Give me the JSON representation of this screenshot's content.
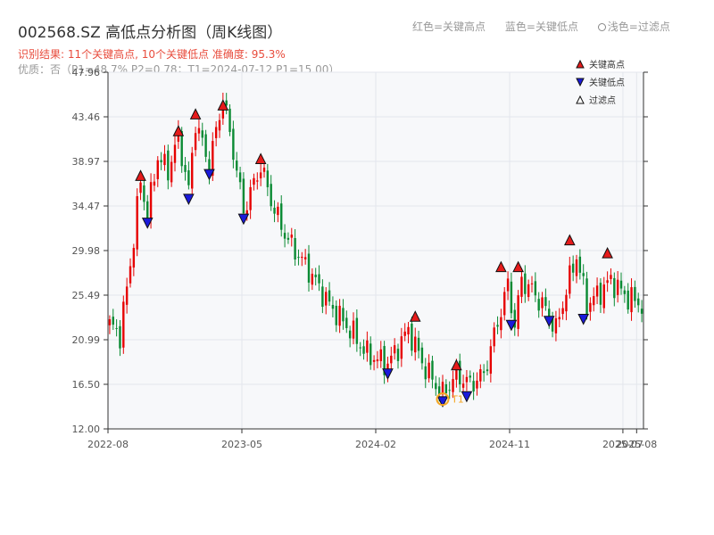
{
  "header": {
    "title": "002568.SZ 高低点分析图（周K线图）",
    "hint_red": "红色=关键高点",
    "hint_blue": "蓝色=关键低点",
    "hint_hollow": "浅色=过滤点",
    "result": "识别结果: 11个关键高点, 10个关键低点  准确度: 95.3%",
    "quality": "优质：否（P1=48.7%  P2=0.78；T1=2024-07-12 P1=15.00）"
  },
  "colors": {
    "up": "#e60000",
    "down": "#0a8a33",
    "high_marker": "#e61b1b",
    "low_marker": "#1a1adb",
    "t1_ring": "#f5a623",
    "plot_bg": "#f7f8fa",
    "grid": "#e3e6ec"
  },
  "chart_data": {
    "type": "candlestick",
    "y_ticks": [
      "47.96",
      "43.46",
      "38.97",
      "34.47",
      "29.98",
      "25.49",
      "20.99",
      "16.50",
      "12.00"
    ],
    "ylim": [
      12.0,
      47.96
    ],
    "x_ticks": [
      {
        "label": "2022-08",
        "index": 0
      },
      {
        "label": "2023-05",
        "index": 39
      },
      {
        "label": "2024-02",
        "index": 78
      },
      {
        "label": "2024-11",
        "index": 117
      },
      {
        "label": "2025-07",
        "index": 150
      },
      {
        "label": "2025-08",
        "index": 154
      }
    ],
    "bars": 156,
    "anchors": [
      [
        0,
        22.5
      ],
      [
        3,
        21.5
      ],
      [
        6,
        28.5
      ],
      [
        9,
        37.0
      ],
      [
        11,
        33.5
      ],
      [
        14,
        39.5
      ],
      [
        17,
        38.0
      ],
      [
        20,
        41.5
      ],
      [
        23,
        36.0
      ],
      [
        25,
        43.0
      ],
      [
        29,
        38.5
      ],
      [
        31,
        42.0
      ],
      [
        33,
        45.5
      ],
      [
        36,
        40.0
      ],
      [
        39,
        34.0
      ],
      [
        44,
        38.5
      ],
      [
        48,
        34.0
      ],
      [
        52,
        31.0
      ],
      [
        58,
        28.0
      ],
      [
        64,
        24.5
      ],
      [
        70,
        22.0
      ],
      [
        75,
        19.5
      ],
      [
        81,
        18.5
      ],
      [
        87,
        22.0
      ],
      [
        92,
        18.0
      ],
      [
        97,
        15.5
      ],
      [
        101,
        17.5
      ],
      [
        105,
        16.5
      ],
      [
        109,
        17.5
      ],
      [
        114,
        24.0
      ],
      [
        116,
        26.5
      ],
      [
        118,
        22.5
      ],
      [
        120,
        27.0
      ],
      [
        123,
        26.0
      ],
      [
        127,
        24.0
      ],
      [
        130,
        22.0
      ],
      [
        133,
        26.0
      ],
      [
        136,
        29.5
      ],
      [
        139,
        24.5
      ],
      [
        142,
        25.5
      ],
      [
        146,
        27.0
      ],
      [
        150,
        25.5
      ],
      [
        155,
        24.5
      ]
    ],
    "key_highs": [
      [
        9,
        37.5
      ],
      [
        20,
        42.0
      ],
      [
        25,
        43.7
      ],
      [
        33,
        44.6
      ],
      [
        44,
        39.2
      ],
      [
        89,
        23.3
      ],
      [
        101,
        18.4
      ],
      [
        114,
        28.3
      ],
      [
        119,
        28.3
      ],
      [
        134,
        31.0
      ],
      [
        145,
        29.7
      ]
    ],
    "key_lows": [
      [
        11,
        32.8
      ],
      [
        23,
        35.2
      ],
      [
        29,
        37.7
      ],
      [
        39,
        33.2
      ],
      [
        81,
        17.6
      ],
      [
        97,
        14.8
      ],
      [
        104,
        15.3
      ],
      [
        117,
        22.5
      ],
      [
        128,
        22.9
      ],
      [
        138,
        23.1
      ]
    ],
    "t1": {
      "label": "T1",
      "index": 97,
      "price": 15.0
    },
    "legend": [
      {
        "label": "关键高点",
        "kind": "high"
      },
      {
        "label": "关键低点",
        "kind": "low"
      },
      {
        "label": "过滤点",
        "kind": "filtered"
      }
    ]
  }
}
